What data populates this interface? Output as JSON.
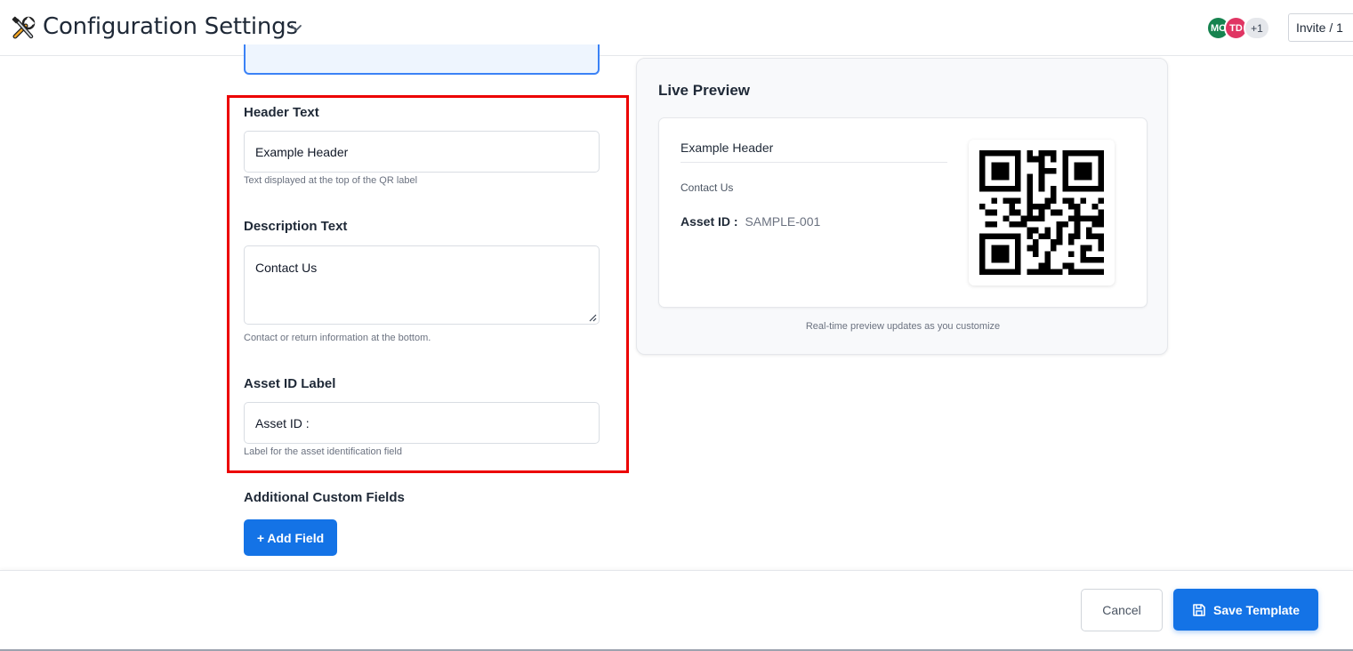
{
  "header": {
    "title": "Configuration Settings",
    "app_icon": "tools-icon",
    "avatars": [
      {
        "initials": "MC",
        "color": "#16834f"
      },
      {
        "initials": "TD",
        "color": "#e03563"
      },
      {
        "initials": "+1",
        "color": "#e5e7eb"
      }
    ],
    "invite_label": "Invite / 1"
  },
  "form": {
    "header_text": {
      "label": "Header Text",
      "value": "Example Header",
      "helper": "Text displayed at the top of the QR label"
    },
    "description_text": {
      "label": "Description Text",
      "value": "Contact Us",
      "helper": "Contact or return information at the bottom."
    },
    "asset_id_label": {
      "label": "Asset ID Label",
      "value": "Asset ID :",
      "helper": "Label for the asset identification field"
    },
    "custom_fields": {
      "label": "Additional Custom Fields",
      "add_button": "+ Add Field"
    }
  },
  "preview": {
    "title": "Live Preview",
    "label_header": "Example Header",
    "label_description": "Contact Us",
    "asset_label": "Asset ID :",
    "asset_value": "SAMPLE-001",
    "note": "Real-time preview updates as you customize"
  },
  "footer": {
    "cancel_label": "Cancel",
    "save_label": "Save Template"
  },
  "colors": {
    "primary": "#1473e6",
    "highlight": "#ec0000"
  }
}
